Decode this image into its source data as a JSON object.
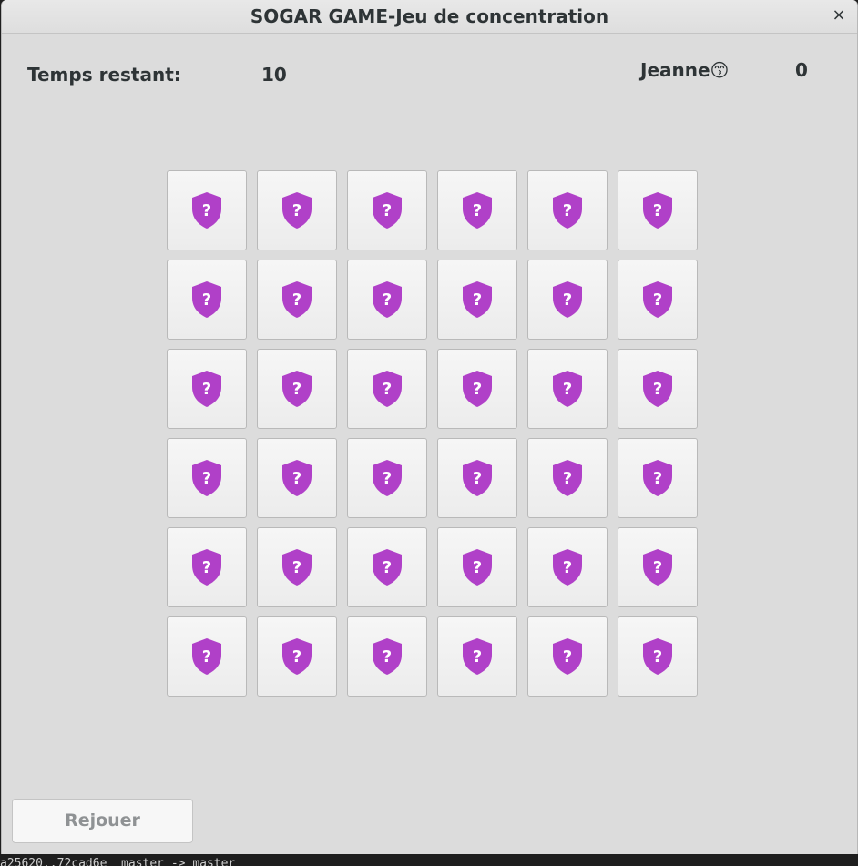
{
  "window": {
    "title": "SOGAR GAME-Jeu de concentration",
    "close_icon": "close-icon",
    "close_glyph": "×"
  },
  "status": {
    "timer_label": "Temps restant:",
    "timer_value": "10",
    "player_name": "Jeanne😙",
    "player_score": "0"
  },
  "board": {
    "rows": 6,
    "columns": 6,
    "card_icon": "shield-question-icon",
    "card_state": "face-down",
    "icon_color": "#b040c8",
    "icon_glyph": "?"
  },
  "actions": {
    "replay_label": "Rejouer"
  },
  "background": {
    "terminal_text": "a25620..72cad6e  master -> master"
  },
  "colors": {
    "window_bg": "#dcdcdc",
    "card_bg": "#f2f2f2",
    "accent": "#b040c8",
    "text": "#2e3436",
    "disabled_text": "#8f9294"
  }
}
